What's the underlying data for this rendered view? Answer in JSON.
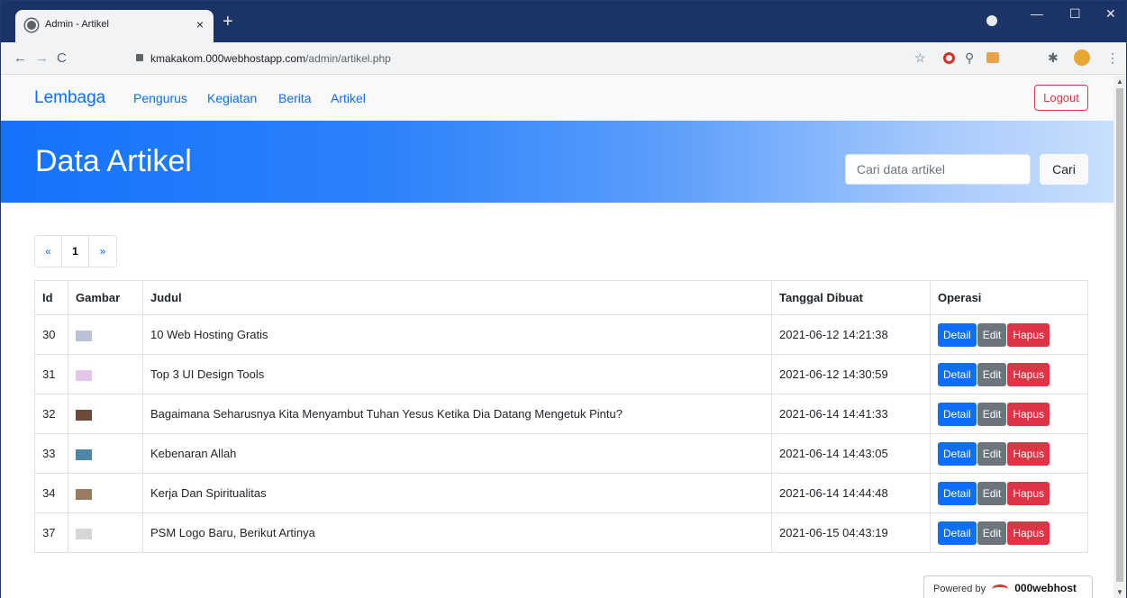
{
  "browser": {
    "tab_title": "Admin - Artikel",
    "tab_close": "×",
    "new_tab": "+",
    "url_host": "kmakakom.000webhostapp.com",
    "url_path": "/admin/artikel.php",
    "minimize": "—",
    "maximize": "☐",
    "close": "✕"
  },
  "navbar": {
    "brand": "Lembaga",
    "links": [
      "Pengurus",
      "Kegiatan",
      "Berita",
      "Artikel"
    ],
    "logout": "Logout"
  },
  "hero": {
    "title": "Data Artikel",
    "search_placeholder": "Cari data artikel",
    "search_button": "Cari"
  },
  "pagination": {
    "prev": "«",
    "current": "1",
    "next": "»"
  },
  "table": {
    "headers": [
      "Id",
      "Gambar",
      "Judul",
      "Tanggal Dibuat",
      "Operasi"
    ],
    "rows": [
      {
        "id": "30",
        "judul": "10 Web Hosting Gratis",
        "tanggal": "2021-06-12 14:21:38",
        "thumb_color": "#b9c2d6"
      },
      {
        "id": "31",
        "judul": "Top 3 UI Design Tools",
        "tanggal": "2021-06-12 14:30:59",
        "thumb_color": "#e3c6e8"
      },
      {
        "id": "32",
        "judul": "Bagaimana Seharusnya Kita Menyambut Tuhan Yesus Ketika Dia Datang Mengetuk Pintu?",
        "tanggal": "2021-06-14 14:41:33",
        "thumb_color": "#6b4a3a"
      },
      {
        "id": "33",
        "judul": "Kebenaran Allah",
        "tanggal": "2021-06-14 14:43:05",
        "thumb_color": "#4f86a8"
      },
      {
        "id": "34",
        "judul": "Kerja Dan Spiritualitas",
        "tanggal": "2021-06-14 14:44:48",
        "thumb_color": "#9a7b62"
      },
      {
        "id": "37",
        "judul": "PSM Logo Baru, Berikut Artinya",
        "tanggal": "2021-06-15 04:43:19",
        "thumb_color": "#d6d6d6"
      }
    ],
    "buttons": {
      "detail": "Detail",
      "edit": "Edit",
      "hapus": "Hapus"
    }
  },
  "footer": {
    "powered_by": "Powered by",
    "host": "000webhost"
  }
}
